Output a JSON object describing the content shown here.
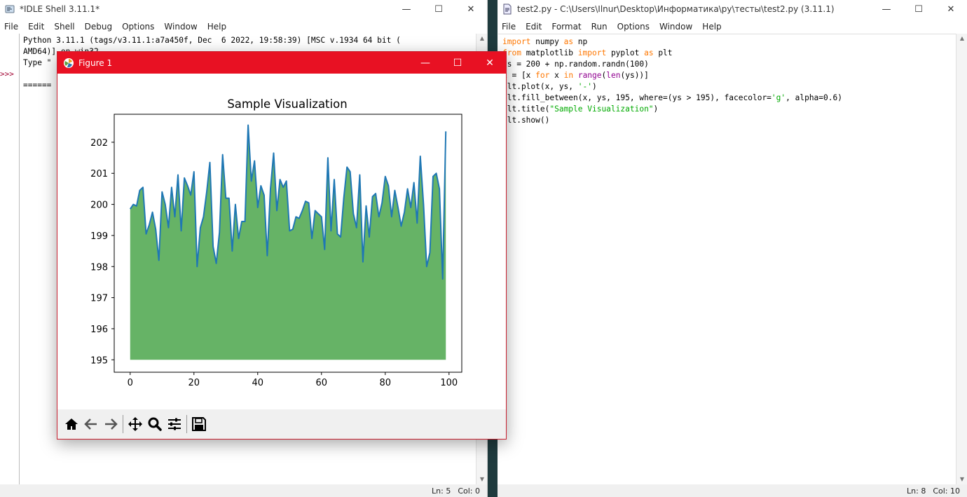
{
  "shell": {
    "title": "*IDLE Shell 3.11.1*",
    "menu": [
      "File",
      "Edit",
      "Shell",
      "Debug",
      "Options",
      "Window",
      "Help"
    ],
    "lines": [
      "Python 3.11.1 (tags/v3.11.1:a7a450f, Dec  6 2022, 19:58:39) [MSC v.1934 64 bit (",
      "AMD64)] on win32",
      "Type \"",
      "",
      "======"
    ],
    "prompt": ">>>",
    "status_ln": "Ln: 5",
    "status_col": "Col: 0"
  },
  "editor": {
    "title": "test2.py - C:\\Users\\Ilnur\\Desktop\\Информатика\\py\\тесты\\test2.py (3.11.1)",
    "menu": [
      "File",
      "Edit",
      "Format",
      "Run",
      "Options",
      "Window",
      "Help"
    ],
    "code": [
      [
        [
          "kw",
          "import"
        ],
        [
          "t",
          " numpy "
        ],
        [
          "kw",
          "as"
        ],
        [
          "t",
          " np"
        ]
      ],
      [
        [
          "kw",
          "from"
        ],
        [
          "t",
          " matplotlib "
        ],
        [
          "kw",
          "import"
        ],
        [
          "t",
          " pyplot "
        ],
        [
          "kw",
          "as"
        ],
        [
          "t",
          " plt"
        ]
      ],
      [
        [
          "t",
          "ys = 200 + np.random.randn(100)"
        ]
      ],
      [
        [
          "t",
          "x = [x "
        ],
        [
          "kw",
          "for"
        ],
        [
          "t",
          " x "
        ],
        [
          "kw",
          "in"
        ],
        [
          "t",
          " "
        ],
        [
          "bi",
          "range"
        ],
        [
          "t",
          "("
        ],
        [
          "bi",
          "len"
        ],
        [
          "t",
          "(ys))]"
        ]
      ],
      [
        [
          "t",
          "plt.plot(x, ys, "
        ],
        [
          "str",
          "'-'"
        ],
        [
          "t",
          ")"
        ]
      ],
      [
        [
          "t",
          "plt.fill_between(x, ys, 195, where=(ys > 195), facecolor="
        ],
        [
          "str",
          "'g'"
        ],
        [
          "t",
          ", alpha=0.6)"
        ]
      ],
      [
        [
          "t",
          "plt.title("
        ],
        [
          "str",
          "\"Sample Visualization\""
        ],
        [
          "t",
          ")"
        ]
      ],
      [
        [
          "t",
          "plt.show()"
        ]
      ]
    ],
    "status_ln": "Ln: 8",
    "status_col": "Col: 10"
  },
  "figure": {
    "title": "Figure 1",
    "toolbar": [
      "home-icon",
      "back-icon",
      "forward-icon",
      "pan-icon",
      "zoom-icon",
      "configure-icon",
      "save-icon"
    ]
  },
  "chart_data": {
    "type": "area",
    "title": "Sample Visualization",
    "xlabel": "",
    "ylabel": "",
    "xlim": [
      -5,
      104
    ],
    "ylim": [
      194.6,
      202.9
    ],
    "xticks": [
      0,
      20,
      40,
      60,
      80,
      100
    ],
    "yticks": [
      195,
      196,
      197,
      198,
      199,
      200,
      201,
      202
    ],
    "grid": false,
    "fill_baseline": 195,
    "line_color": "#1f77b4",
    "fill_color": "#008000",
    "fill_alpha": 0.6,
    "x": [
      0,
      1,
      2,
      3,
      4,
      5,
      6,
      7,
      8,
      9,
      10,
      11,
      12,
      13,
      14,
      15,
      16,
      17,
      18,
      19,
      20,
      21,
      22,
      23,
      24,
      25,
      26,
      27,
      28,
      29,
      30,
      31,
      32,
      33,
      34,
      35,
      36,
      37,
      38,
      39,
      40,
      41,
      42,
      43,
      44,
      45,
      46,
      47,
      48,
      49,
      50,
      51,
      52,
      53,
      54,
      55,
      56,
      57,
      58,
      59,
      60,
      61,
      62,
      63,
      64,
      65,
      66,
      67,
      68,
      69,
      70,
      71,
      72,
      73,
      74,
      75,
      76,
      77,
      78,
      79,
      80,
      81,
      82,
      83,
      84,
      85,
      86,
      87,
      88,
      89,
      90,
      91,
      92,
      93,
      94,
      95,
      96,
      97,
      98,
      99
    ],
    "values": [
      199.85,
      200.0,
      199.95,
      200.45,
      200.55,
      199.05,
      199.35,
      199.75,
      199.2,
      198.2,
      200.4,
      200.0,
      199.25,
      200.55,
      199.6,
      200.95,
      199.15,
      200.85,
      200.6,
      200.3,
      201.05,
      198.0,
      199.25,
      199.6,
      200.4,
      201.35,
      198.65,
      198.1,
      199.1,
      201.6,
      200.2,
      200.2,
      198.5,
      200.0,
      198.9,
      199.45,
      199.45,
      202.55,
      200.75,
      201.4,
      199.9,
      200.6,
      200.3,
      198.35,
      200.5,
      201.65,
      199.8,
      200.8,
      200.55,
      200.75,
      199.15,
      199.2,
      199.6,
      199.55,
      199.8,
      200.1,
      200.05,
      198.9,
      199.8,
      199.7,
      199.6,
      198.55,
      201.5,
      199.15,
      200.8,
      199.05,
      198.95,
      200.2,
      201.2,
      201.05,
      199.7,
      199.25,
      200.95,
      198.15,
      199.95,
      198.95,
      200.25,
      200.35,
      199.6,
      200.05,
      200.9,
      200.6,
      199.6,
      200.45,
      199.9,
      199.3,
      199.75,
      200.5,
      199.9,
      200.7,
      199.4,
      201.55,
      200.0,
      198.0,
      198.45,
      200.9,
      201.0,
      200.5,
      197.6,
      202.35
    ]
  }
}
